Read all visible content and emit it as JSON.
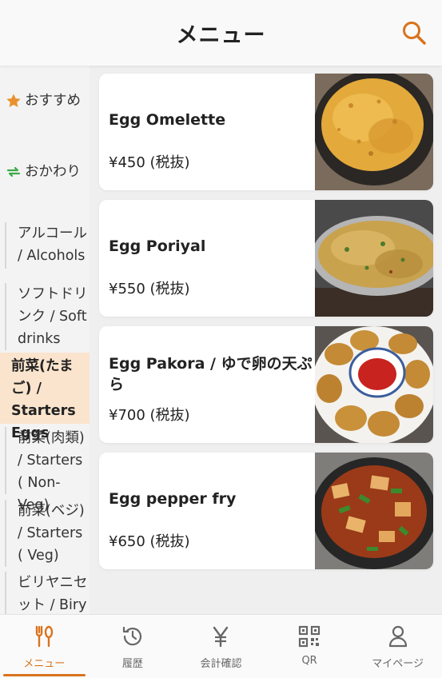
{
  "header": {
    "title": "メニュー"
  },
  "sidebar": {
    "special_items": [
      {
        "label": "おすすめ",
        "icon": "star-icon"
      },
      {
        "label": "おかわり",
        "icon": "refresh-icon"
      }
    ],
    "categories": [
      {
        "label": "アルコール / Alcohols"
      },
      {
        "label": "ソフトドリンク / Soft drinks"
      },
      {
        "label": "前菜(たまご) / Starters Eggs",
        "active": true
      },
      {
        "label": "前菜(肉類) / Starters ( Non- Veg)"
      },
      {
        "label": "前菜(ベジ) / Starters ( Veg)"
      },
      {
        "label": "ビリヤニセット / Biry"
      }
    ]
  },
  "menu_items": [
    {
      "name": "Egg Omelette",
      "price": "¥450 (税抜)"
    },
    {
      "name": "Egg Poriyal",
      "price": "¥550 (税抜)"
    },
    {
      "name": "Egg Pakora / ゆで卵の天ぷら",
      "price": "¥700 (税抜)"
    },
    {
      "name": "Egg pepper fry",
      "price": "¥650 (税抜)"
    }
  ],
  "bottom_nav": [
    {
      "label": "メニュー",
      "icon": "fork-knife-icon",
      "active": true
    },
    {
      "label": "履歴",
      "icon": "history-icon"
    },
    {
      "label": "会計確認",
      "icon": "yen-icon"
    },
    {
      "label": "QR",
      "icon": "qr-code-icon"
    },
    {
      "label": "マイページ",
      "icon": "person-icon"
    }
  ],
  "colors": {
    "accent": "#d9731c",
    "active_bg": "#fbe4cd",
    "refresh_green": "#3aaa48"
  }
}
